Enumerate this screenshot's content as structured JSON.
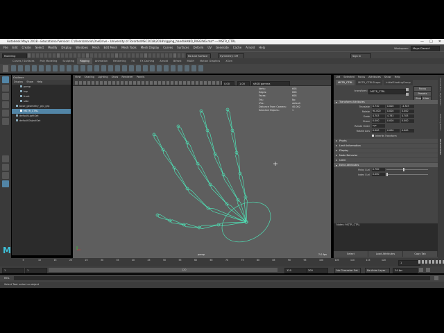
{
  "window": {
    "title": "Autodesk Maya 2018 - Educational Version: C:\\Users\\maria\\OneDrive - University of Toronto\\MSC2018\\2018\\rigging_hand\\HAND_RIGGING.ma* --- MSTR_CTRL"
  },
  "menubar": {
    "items": [
      "File",
      "Edit",
      "Create",
      "Select",
      "Modify",
      "Display",
      "Windows",
      "Mesh",
      "Edit Mesh",
      "Mesh Tools",
      "Mesh Display",
      "Curves",
      "Surfaces",
      "Deform",
      "UV",
      "Generate",
      "Cache",
      "Arnold",
      "Help"
    ],
    "workspace_label": "Workspace:",
    "workspace_value": "Maya Classic*"
  },
  "statusline": {
    "mode": "Modeling",
    "live_surface": "No Live Surface",
    "symmetry": "Symmetry: Off",
    "sign_in": "Sign In"
  },
  "shelf": {
    "tabs": [
      "Curves / Surfaces",
      "Poly Modeling",
      "Sculpting",
      "Rigging",
      "Animation",
      "Rendering",
      "FX",
      "FX Caching",
      "Arnold",
      "Bifrost",
      "MASH",
      "Motion Graphics",
      "XGen"
    ],
    "active_tab": "Rigging"
  },
  "outliner": {
    "title": "Outliner",
    "menu": [
      "Display",
      "Show",
      "Help"
    ],
    "items": [
      {
        "label": "persp",
        "indent": 1
      },
      {
        "label": "top",
        "indent": 1
      },
      {
        "label": "front",
        "indent": 1
      },
      {
        "label": "side",
        "indent": 1
      },
      {
        "label": "base_geometry_grp_grp",
        "indent": 0
      },
      {
        "label": "MSTR_CTRL",
        "indent": 1,
        "selected": true
      },
      {
        "label": "defaultLightSet",
        "indent": 0
      },
      {
        "label": "defaultObjectSet",
        "indent": 0
      }
    ]
  },
  "viewport": {
    "menu": [
      "View",
      "Shading",
      "Lighting",
      "Show",
      "Renderer",
      "Panels"
    ],
    "exposure": "0.00",
    "gamma": "1.00",
    "color_space": "sRGB gamma",
    "hud": [
      {
        "k": "Verts:",
        "v": "608"
      },
      {
        "k": "Edges:",
        "v": "608"
      },
      {
        "k": "Faces:",
        "v": "608"
      },
      {
        "k": "Tris:",
        "v": "No"
      },
      {
        "k": "UVs:",
        "v": "default"
      },
      {
        "k": "Distance From Camera:",
        "v": "40.062"
      },
      {
        "k": "Selected Objects:",
        "v": "1"
      }
    ],
    "camera_label": "persp",
    "fps": "7.0 fps"
  },
  "attribute_editor": {
    "menu": [
      "List",
      "Selected",
      "Focus",
      "Attributes",
      "Show",
      "Help"
    ],
    "tabs": [
      "MSTR_CTRL",
      "MSTR_CTRLShape",
      "initialShadingGroup"
    ],
    "transform_label": "transform:",
    "transform_value": "MSTR_CTRL",
    "buttons": [
      "Focus",
      "Presets",
      "Show",
      "Hide"
    ],
    "sections": {
      "transform": "Transform Attributes",
      "pivots": "Pivots",
      "limit": "Limit Information",
      "display": "Display",
      "node_behavior": "Node Behavior",
      "uuid": "UUID",
      "extra": "Extra Attributes"
    },
    "translate": {
      "label": "Translate",
      "values": [
        "0.740",
        "0.000",
        "-4.303"
      ]
    },
    "rotate": {
      "label": "Rotate",
      "values": [
        "90.000",
        "0.000",
        "0.000"
      ]
    },
    "scale": {
      "label": "Scale",
      "values": [
        "4.783",
        "4.783",
        "4.783"
      ]
    },
    "shear": {
      "label": "Shear",
      "values": [
        "0.000",
        "0.000",
        "0.000"
      ]
    },
    "rotate_order": {
      "label": "Rotate Order",
      "value": "xyz"
    },
    "rotate_axis": {
      "label": "Rotate Axis",
      "values": [
        "0.000",
        "0.000",
        "0.000"
      ]
    },
    "inherits": "Inherits Transform",
    "pinky_curl": {
      "label": "Pinky Curl",
      "value": "0.780"
    },
    "index_curl": {
      "label": "Index Curl",
      "value": "0.000"
    },
    "notes_label": "Notes: MSTR_CTRL",
    "bottom_buttons": [
      "Select",
      "Load Attributes",
      "Copy Tab"
    ]
  },
  "right_strip": [
    "Channel Box / Layer Editor",
    "Modeling Toolkit",
    "Attribute Editor"
  ],
  "timeline": {
    "ticks": [
      "5",
      "10",
      "15",
      "20",
      "25",
      "30",
      "35",
      "40",
      "45",
      "50",
      "55",
      "60",
      "65",
      "70",
      "75",
      "80",
      "85",
      "90",
      "95",
      "100",
      "105",
      "110",
      "115",
      "120"
    ],
    "current_frame": "1"
  },
  "range": {
    "start": "1",
    "playback_start": "1",
    "slider_value": "120",
    "playback_end": "120",
    "end": "200",
    "character": "No Character Set",
    "anim_layer": "No Anim Layer",
    "fps": "24 fps"
  },
  "command": {
    "label": "MEL"
  },
  "help": {
    "text": "Select Tool: select an object"
  },
  "colors": {
    "wire": "#4fe0b5",
    "selected": "#5285a6",
    "viewport_bg": "#5e5e5e"
  }
}
